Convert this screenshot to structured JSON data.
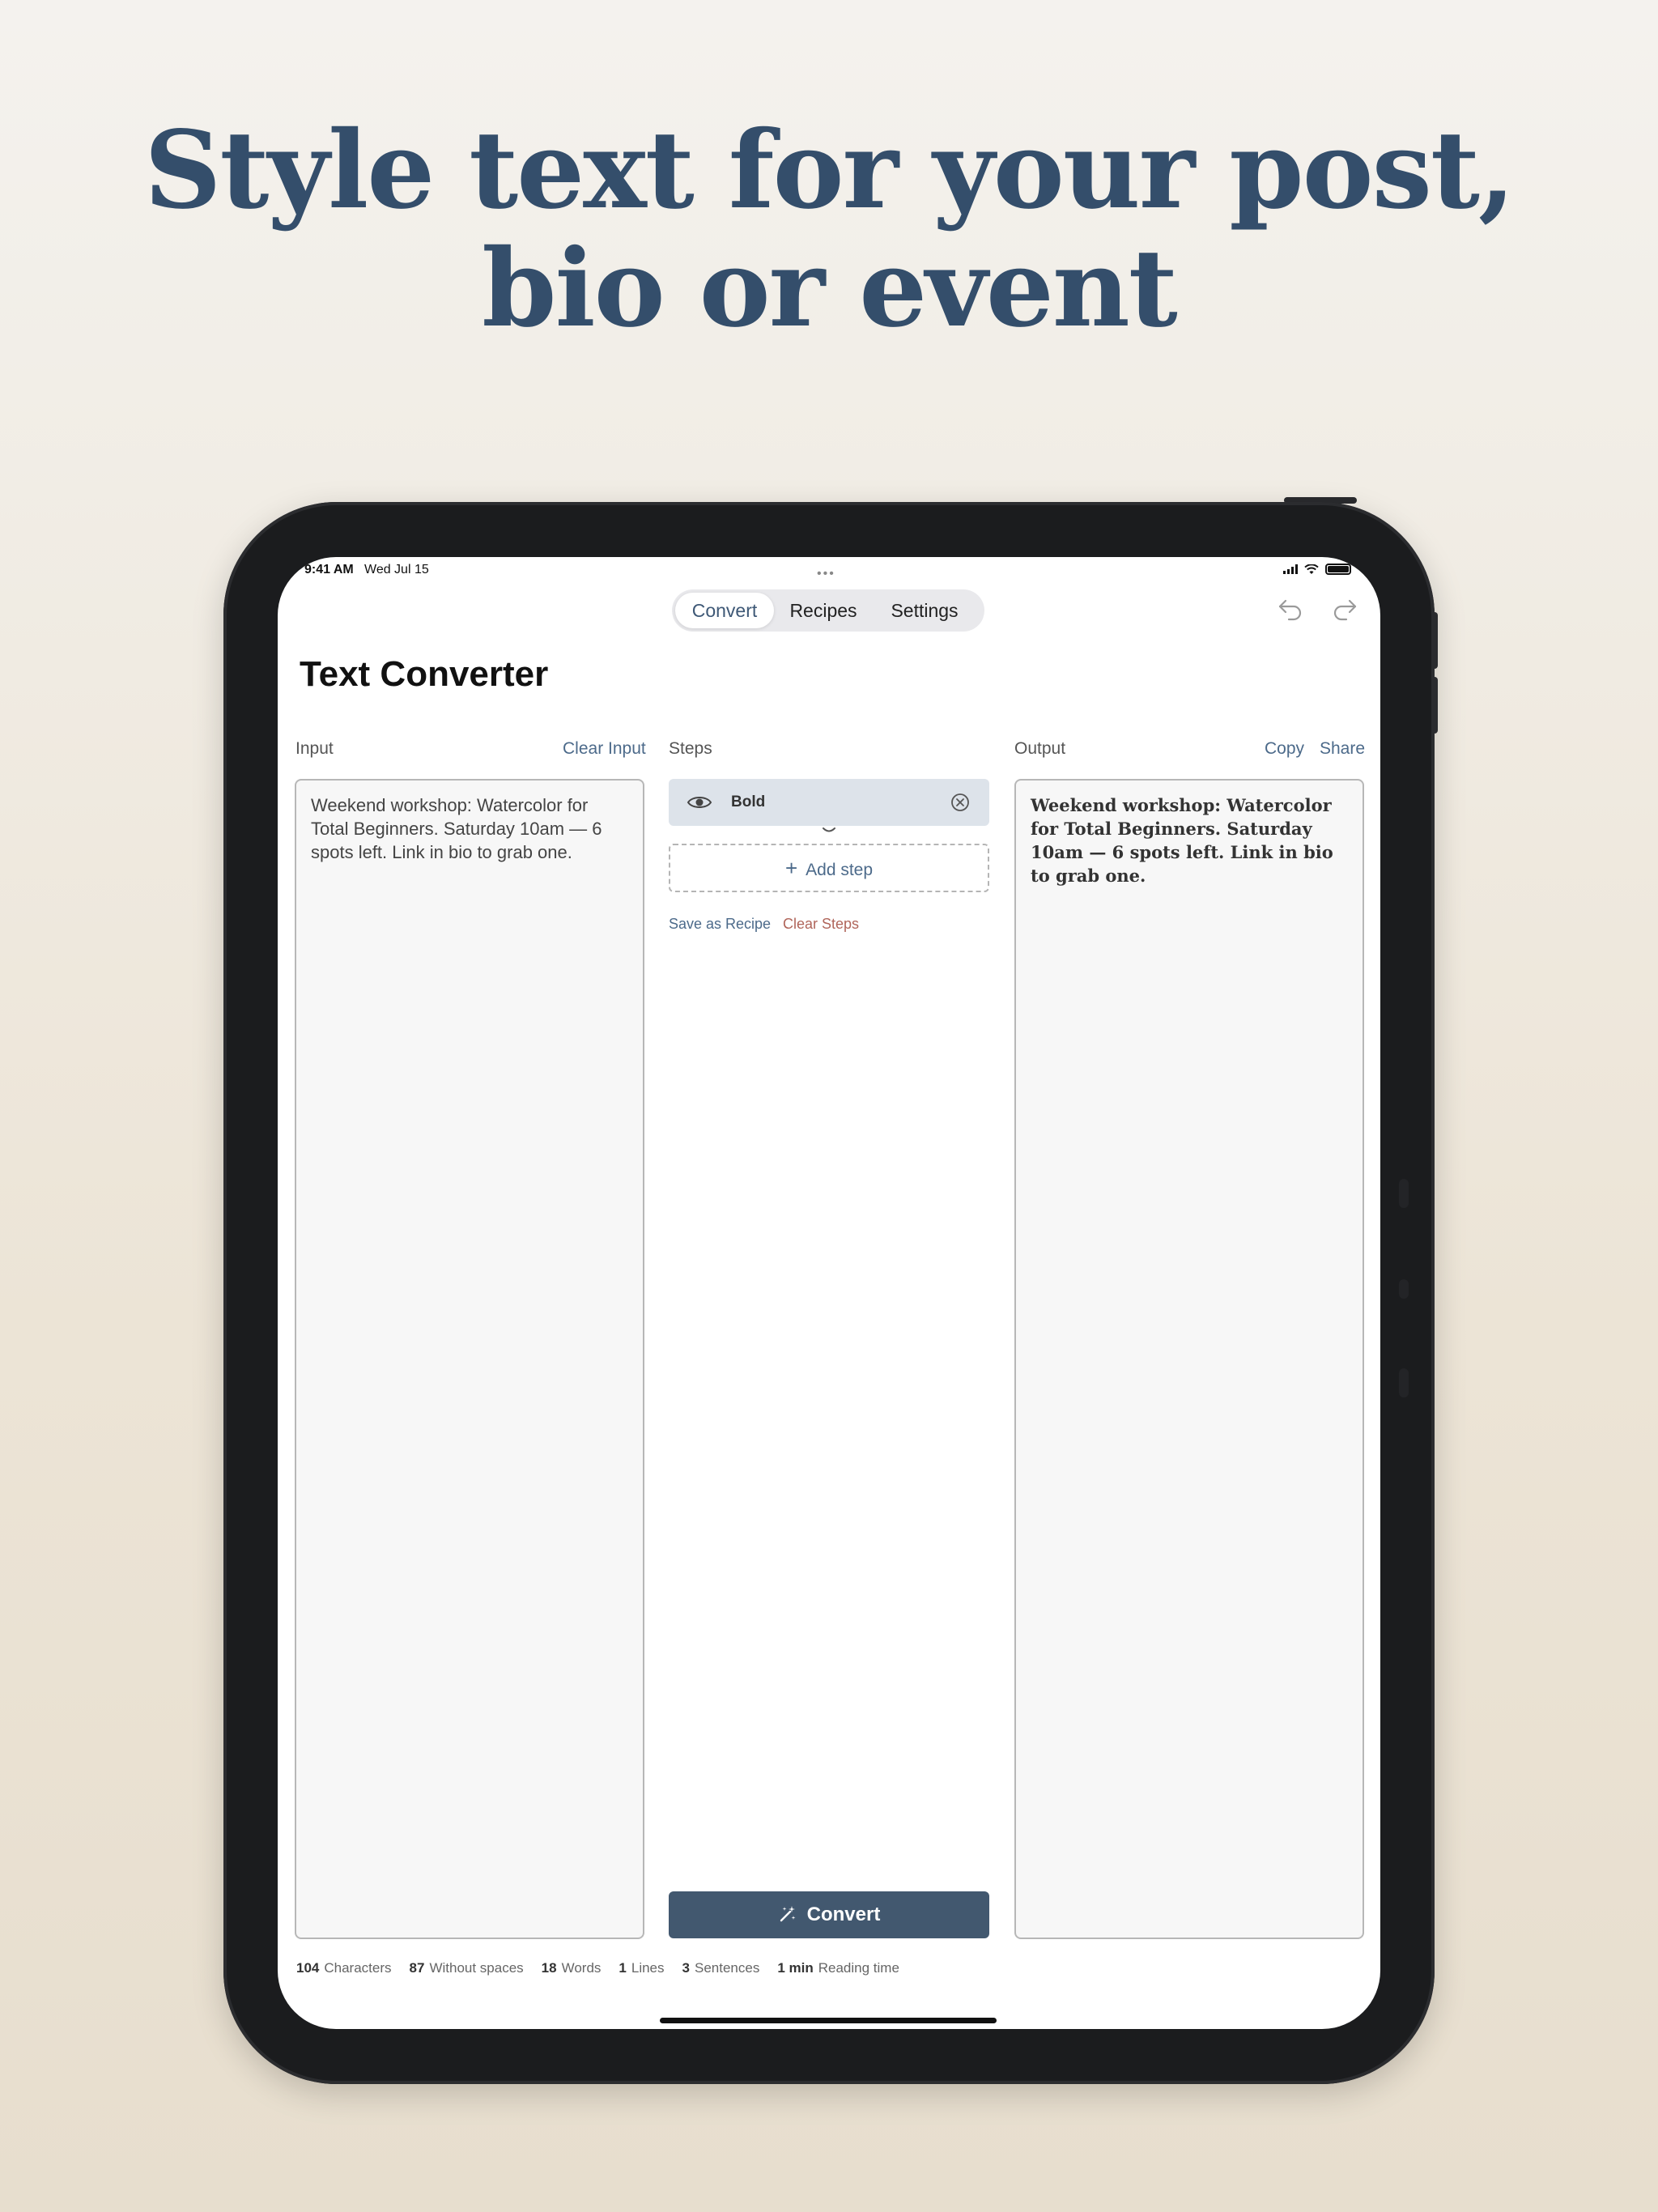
{
  "headline": {
    "line1": "Style text for your post,",
    "line2": "bio or event"
  },
  "status_bar": {
    "time": "9:41 AM",
    "date": "Wed Jul 15",
    "more": "•••"
  },
  "nav": {
    "tabs": [
      "Convert",
      "Recipes",
      "Settings"
    ],
    "active_tab": "Convert",
    "undo_icon": "undo-icon",
    "redo_icon": "redo-icon"
  },
  "page_title": "Text Converter",
  "input": {
    "label": "Input",
    "action": "Clear Input",
    "value": "Weekend workshop: Watercolor for Total Beginners. Saturday 10am — 6 spots left. Link in bio to grab one."
  },
  "steps": {
    "label": "Steps",
    "items": [
      {
        "label": "Bold",
        "icon": "eye-icon",
        "remove_icon": "remove-circle-icon"
      }
    ],
    "add_step": "Add step",
    "save_recipe": "Save as Recipe",
    "clear_steps": "Clear Steps",
    "convert_button": "Convert"
  },
  "output": {
    "label": "Output",
    "copy": "Copy",
    "share": "Share",
    "value": "Weekend workshop: Watercolor for Total Beginners. Saturday 10am — 6 spots left. Link in bio to grab one."
  },
  "stats": [
    {
      "value": "104",
      "label": "Characters"
    },
    {
      "value": "87",
      "label": "Without spaces"
    },
    {
      "value": "18",
      "label": "Words"
    },
    {
      "value": "1",
      "label": "Lines"
    },
    {
      "value": "3",
      "label": "Sentences"
    },
    {
      "value": "1 min",
      "label": "Reading time"
    }
  ],
  "colors": {
    "headline": "#344e6b",
    "accent": "#4c6a8a",
    "convert_button": "#42586f",
    "destructive": "#b0655a"
  }
}
